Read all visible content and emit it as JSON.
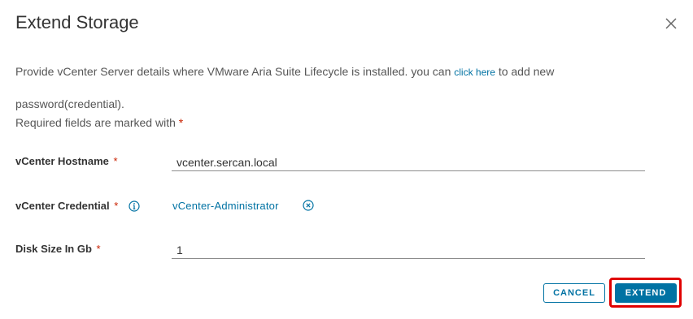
{
  "dialog": {
    "title": "Extend Storage",
    "close_icon": "close-icon"
  },
  "description": {
    "line1_prefix": "Provide vCenter Server details where VMware Aria Suite Lifecycle is installed. you can ",
    "link_text": "click here",
    "line1_suffix": " to add new",
    "line2": "password(credential).",
    "required_note": "Required fields are marked with",
    "required_marker": "*"
  },
  "form": {
    "hostname": {
      "label": "vCenter Hostname",
      "required_marker": "*",
      "value": "vcenter.sercan.local"
    },
    "credential": {
      "label": "vCenter Credential",
      "required_marker": "*",
      "info_icon": "info-icon",
      "value": "vCenter-Administrator",
      "clear_icon": "clear-circle-icon"
    },
    "disk_size": {
      "label": "Disk Size In Gb",
      "required_marker": "*",
      "value": "1"
    }
  },
  "buttons": {
    "cancel": "CANCEL",
    "extend": "EXTEND"
  },
  "colors": {
    "primary": "#0072a3",
    "required": "#c92100",
    "highlight": "#e00000"
  }
}
